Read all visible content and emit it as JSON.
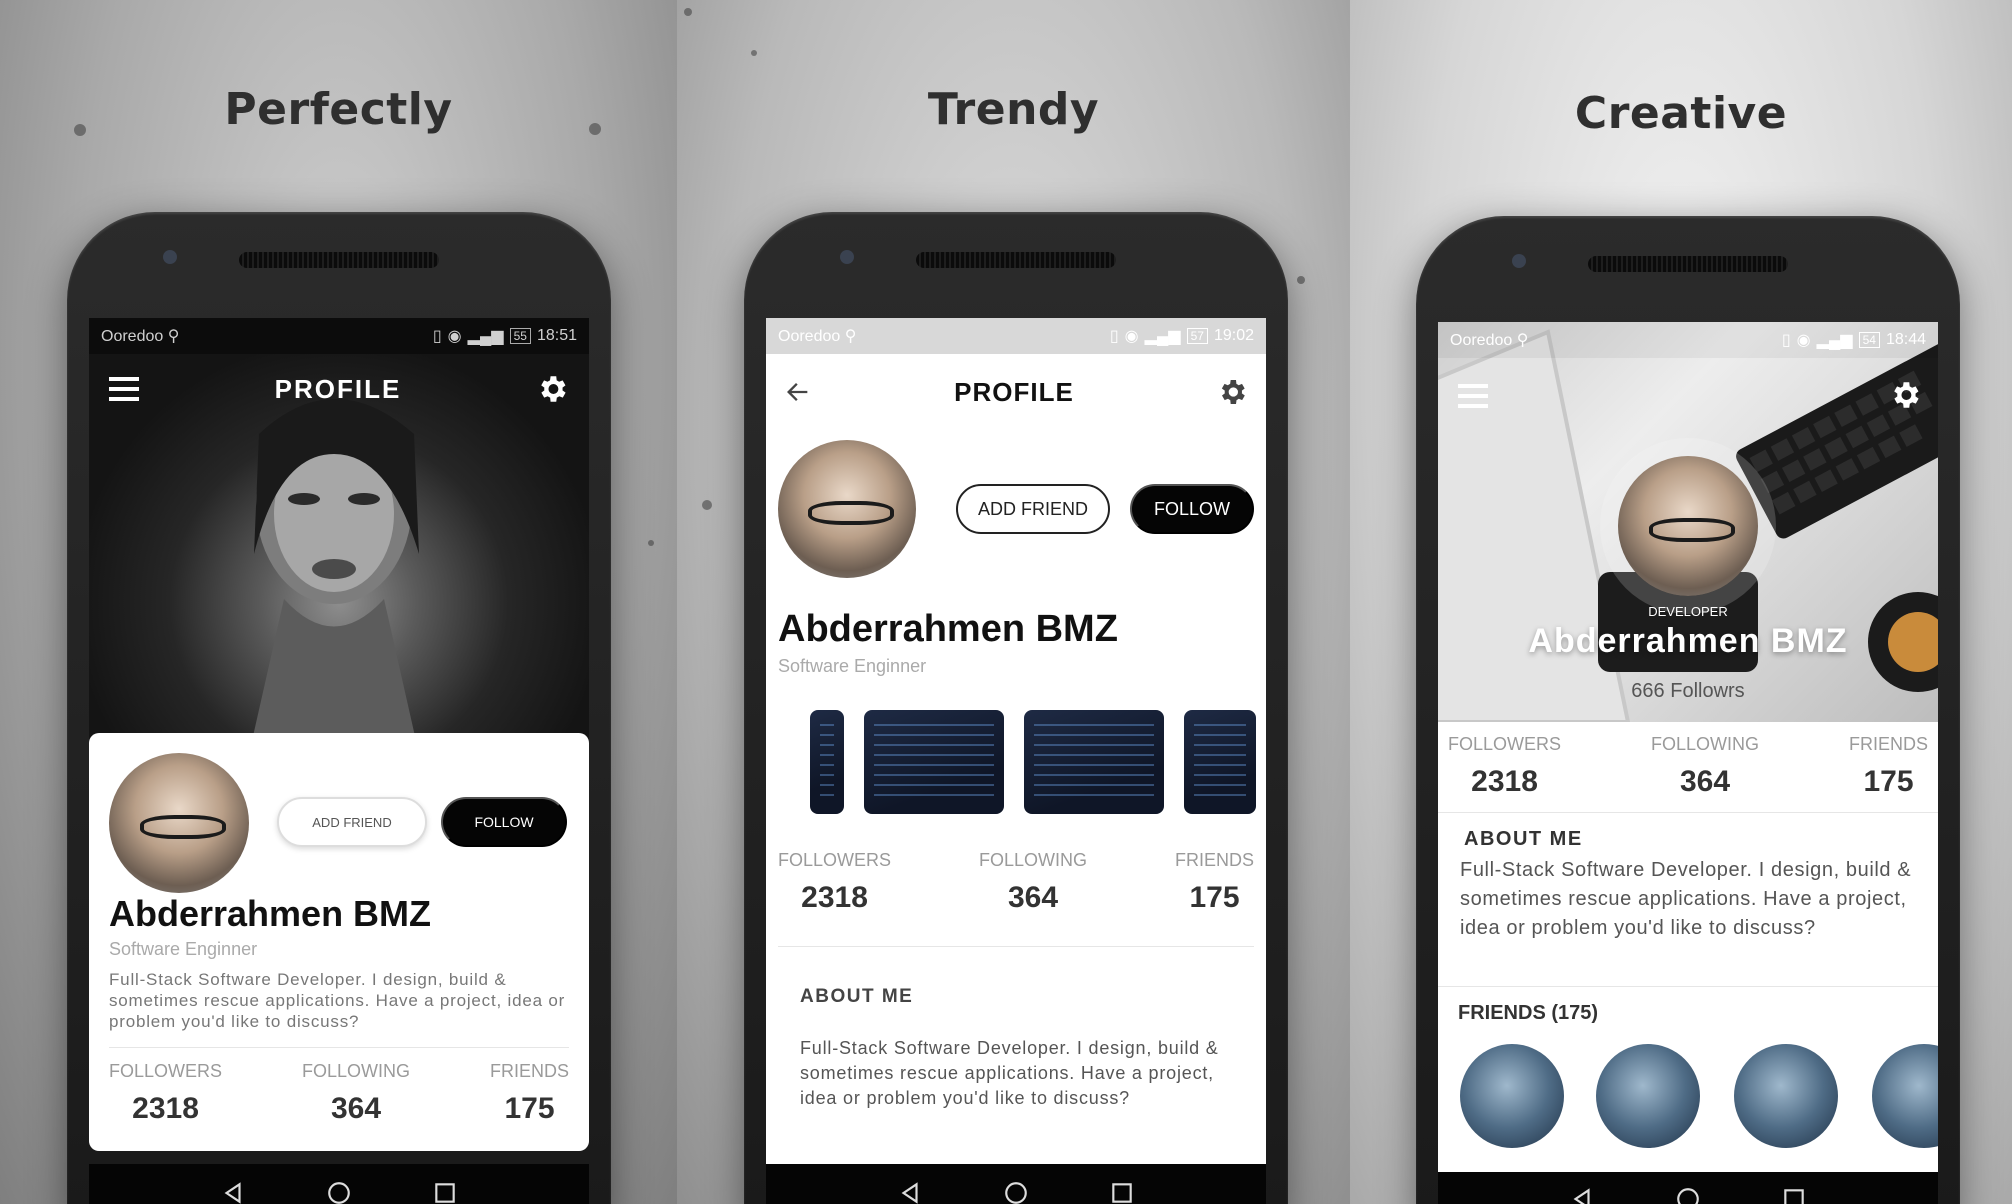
{
  "panels": [
    {
      "headline": "Perfectly",
      "status": {
        "carrier": "Ooredoo",
        "battery": "55",
        "time": "18:51"
      },
      "header": {
        "title": "PROFILE"
      },
      "profile": {
        "name": "Abderrahmen BMZ",
        "role": "Software Enginner",
        "bio": "Full-Stack Software Developer. I design, build & sometimes rescue applications. Have a project, idea or problem you'd like to discuss?",
        "add_friend_label": "ADD FRIEND",
        "follow_label": "FOLLOW"
      },
      "stats": [
        {
          "label": "FOLLOWERS",
          "value": "2318"
        },
        {
          "label": "FOLLOWING",
          "value": "364"
        },
        {
          "label": "FRIENDS",
          "value": "175"
        }
      ]
    },
    {
      "headline": "Trendy",
      "status": {
        "carrier": "Ooredoo",
        "battery": "57",
        "time": "19:02"
      },
      "header": {
        "title": "PROFILE"
      },
      "profile": {
        "name": "Abderrahmen BMZ",
        "role": "Software Enginner",
        "add_friend_label": "ADD FRIEND",
        "follow_label": "FOLLOW"
      },
      "stats": [
        {
          "label": "FOLLOWERS",
          "value": "2318"
        },
        {
          "label": "FOLLOWING",
          "value": "364"
        },
        {
          "label": "FRIENDS",
          "value": "175"
        }
      ],
      "about": {
        "heading": "ABOUT ME",
        "text": "Full-Stack Software Developer. I design, build & sometimes rescue applications. Have a project, idea or problem you'd like to discuss?"
      }
    },
    {
      "headline": "Creative",
      "status": {
        "carrier": "Ooredoo",
        "battery": "54",
        "time": "18:44"
      },
      "profile": {
        "badge": "DEVELOPER",
        "name": "Abderrahmen BMZ",
        "followers_line": "666 Followrs"
      },
      "stats": [
        {
          "label": "FOLLOWERS",
          "value": "2318"
        },
        {
          "label": "FOLLOWING",
          "value": "364"
        },
        {
          "label": "FRIENDS",
          "value": "175"
        }
      ],
      "about": {
        "heading": "ABOUT ME",
        "text": "Full-Stack Software Developer. I design, build & sometimes rescue applications. Have a project, idea or problem you'd like to discuss?"
      },
      "friends_heading": "FRIENDS (175)"
    }
  ],
  "icons": {
    "menu": "hamburger-menu-icon",
    "settings": "gear-icon",
    "back": "arrow-left-icon",
    "nav_back": "triangle-back-icon",
    "nav_home": "circle-home-icon",
    "nav_recent": "square-recent-icon"
  },
  "colors": {
    "accent": "#050505",
    "muted": "#9a9a9a",
    "card": "#ffffff"
  }
}
